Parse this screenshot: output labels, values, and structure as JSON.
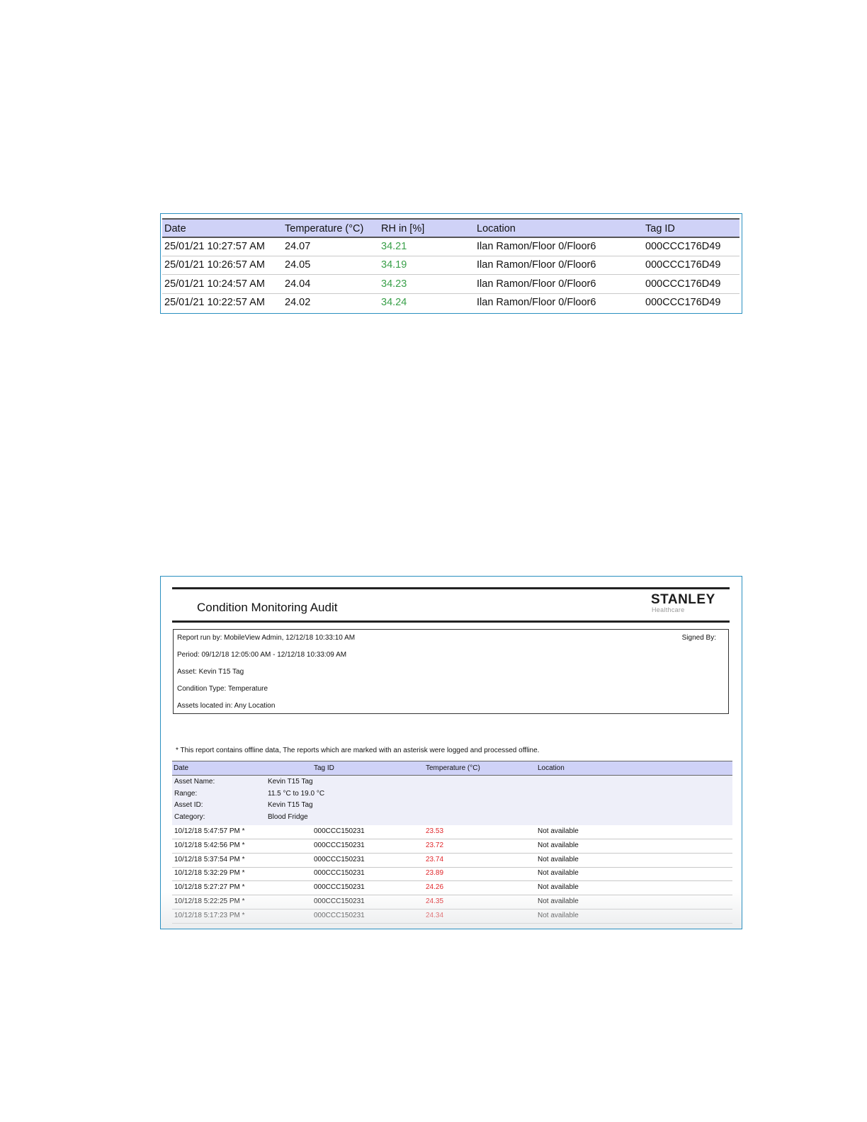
{
  "readings_table": {
    "headers": {
      "date": "Date",
      "temperature": "Temperature (°C)",
      "rh": "RH in [%]",
      "location": "Location",
      "tag_id": "Tag ID"
    },
    "rows": [
      {
        "date": "25/01/21 10:27:57 AM",
        "temperature": "24.07",
        "rh": "34.21",
        "location": "Ilan Ramon/Floor 0/Floor6",
        "tag_id": "000CCC176D49"
      },
      {
        "date": "25/01/21 10:26:57 AM",
        "temperature": "24.05",
        "rh": "34.19",
        "location": "Ilan Ramon/Floor 0/Floor6",
        "tag_id": "000CCC176D49"
      },
      {
        "date": "25/01/21 10:24:57 AM",
        "temperature": "24.04",
        "rh": "34.23",
        "location": "Ilan Ramon/Floor 0/Floor6",
        "tag_id": "000CCC176D49"
      },
      {
        "date": "25/01/21 10:22:57 AM",
        "temperature": "24.02",
        "rh": "34.24",
        "location": "Ilan Ramon/Floor 0/Floor6",
        "tag_id": "000CCC176D49"
      }
    ]
  },
  "audit_report": {
    "title": "Condition Monitoring Audit",
    "logo": {
      "word": "STANLEY",
      "sub": "Healthcare"
    },
    "info": {
      "report_run_by": "Report run by: MobileView Admin, 12/12/18 10:33:10 AM",
      "signed_by": "Signed By:",
      "period": "Period: 09/12/18 12:05:00 AM - 12/12/18 10:33:09 AM",
      "asset": "Asset: Kevin T15 Tag",
      "condition_type": "Condition Type: Temperature",
      "assets_located_in": "Assets located in: Any Location"
    },
    "note": "* This report contains offline data, The reports which are marked with an asterisk were logged and processed offline.",
    "headers": {
      "date": "Date",
      "tag_id": "Tag ID",
      "temperature": "Temperature (°C)",
      "location": "Location"
    },
    "asset_details": {
      "asset_name_label": "Asset Name:",
      "asset_name": "Kevin T15 Tag",
      "range_label": "Range:",
      "range": "11.5 °C to 19.0 °C",
      "asset_id_label": "Asset ID:",
      "asset_id": "Kevin T15 Tag",
      "category_label": "Category:",
      "category": "Blood Fridge"
    },
    "rows": [
      {
        "date": "10/12/18 5:47:57 PM *",
        "tag_id": "000CCC150231",
        "temperature": "23.53",
        "location": "Not available"
      },
      {
        "date": "10/12/18 5:42:56 PM *",
        "tag_id": "000CCC150231",
        "temperature": "23.72",
        "location": "Not available"
      },
      {
        "date": "10/12/18 5:37:54 PM *",
        "tag_id": "000CCC150231",
        "temperature": "23.74",
        "location": "Not available"
      },
      {
        "date": "10/12/18 5:32:29 PM *",
        "tag_id": "000CCC150231",
        "temperature": "23.89",
        "location": "Not available"
      },
      {
        "date": "10/12/18 5:27:27 PM *",
        "tag_id": "000CCC150231",
        "temperature": "24.26",
        "location": "Not available"
      },
      {
        "date": "10/12/18 5:22:25 PM *",
        "tag_id": "000CCC150231",
        "temperature": "24.35",
        "location": "Not available"
      },
      {
        "date": "10/12/18 5:17:23 PM *",
        "tag_id": "000CCC150231",
        "temperature": "24.34",
        "location": "Not available"
      }
    ]
  },
  "colors": {
    "frame_border": "#2a8fc0",
    "header_fill": "#cfd2f7",
    "rh_value": "#3aa04a",
    "out_of_range_temperature": "#e0262a"
  }
}
